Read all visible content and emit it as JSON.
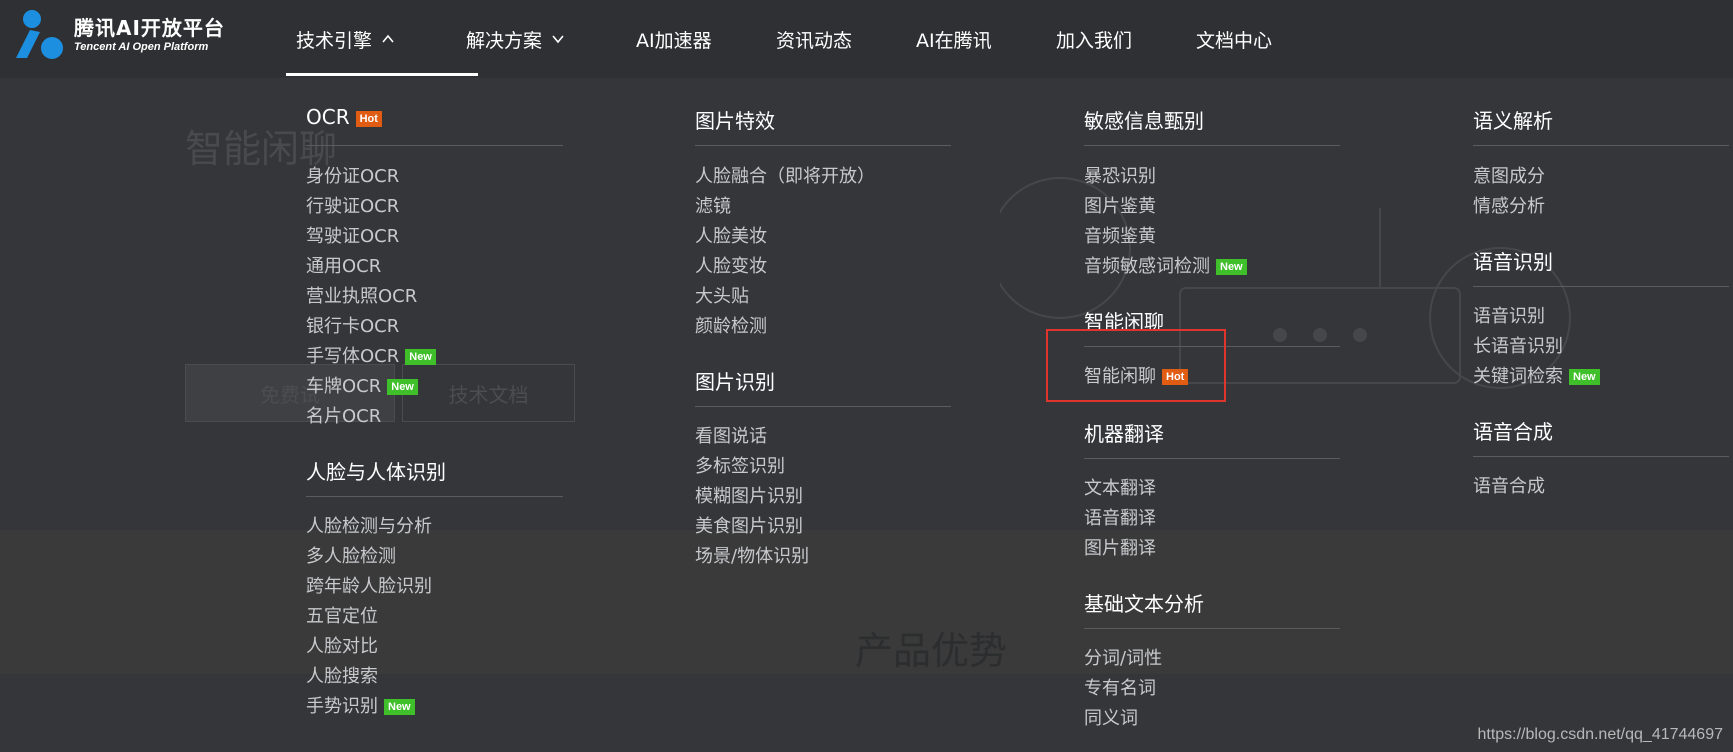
{
  "colors": {
    "hot_badge": "#e05c12",
    "new_badge": "#3fbf2a",
    "highlight_border": "#e0342f",
    "logo_blue": "#1d8fe0"
  },
  "logo": {
    "cn": "腾讯AI开放平台",
    "en": "Tencent AI Open Platform"
  },
  "nav": [
    {
      "label": "技术引擎",
      "chevron": "up"
    },
    {
      "label": "解决方案",
      "chevron": "down"
    },
    {
      "label": "AI加速器"
    },
    {
      "label": "资讯动态"
    },
    {
      "label": "AI在腾讯"
    },
    {
      "label": "加入我们"
    },
    {
      "label": "文档中心"
    }
  ],
  "menu": {
    "ocr": {
      "title": "OCR",
      "badge": "Hot",
      "items": [
        {
          "label": "身份证OCR"
        },
        {
          "label": "行驶证OCR"
        },
        {
          "label": "驾驶证OCR"
        },
        {
          "label": "通用OCR"
        },
        {
          "label": "营业执照OCR"
        },
        {
          "label": "银行卡OCR"
        },
        {
          "label": "手写体OCR",
          "badge": "New"
        },
        {
          "label": "车牌OCR",
          "badge": "New"
        },
        {
          "label": "名片OCR"
        }
      ]
    },
    "face": {
      "title": "人脸与人体识别",
      "items": [
        {
          "label": "人脸检测与分析"
        },
        {
          "label": "多人脸检测"
        },
        {
          "label": "跨年龄人脸识别"
        },
        {
          "label": "五官定位"
        },
        {
          "label": "人脸对比"
        },
        {
          "label": "人脸搜索"
        },
        {
          "label": "手势识别",
          "badge": "New"
        }
      ]
    },
    "effects": {
      "title": "图片特效",
      "items": [
        {
          "label": "人脸融合（即将开放）"
        },
        {
          "label": "滤镜"
        },
        {
          "label": "人脸美妆"
        },
        {
          "label": "人脸变妆"
        },
        {
          "label": "大头贴"
        },
        {
          "label": "颜龄检测"
        }
      ]
    },
    "image_rec": {
      "title": "图片识别",
      "items": [
        {
          "label": "看图说话"
        },
        {
          "label": "多标签识别"
        },
        {
          "label": "模糊图片识别"
        },
        {
          "label": "美食图片识别"
        },
        {
          "label": "场景/物体识别"
        }
      ]
    },
    "sensitive": {
      "title": "敏感信息甄别",
      "items": [
        {
          "label": "暴恐识别"
        },
        {
          "label": "图片鉴黄"
        },
        {
          "label": "音频鉴黄"
        },
        {
          "label": "音频敏感词检测",
          "badge": "New"
        }
      ]
    },
    "chat": {
      "title": "智能闲聊",
      "items": [
        {
          "label": "智能闲聊",
          "badge": "Hot"
        }
      ]
    },
    "translate": {
      "title": "机器翻译",
      "items": [
        {
          "label": "文本翻译"
        },
        {
          "label": "语音翻译"
        },
        {
          "label": "图片翻译"
        }
      ]
    },
    "text": {
      "title": "基础文本分析",
      "items": [
        {
          "label": "分词/词性"
        },
        {
          "label": "专有名词"
        },
        {
          "label": "同义词"
        }
      ]
    },
    "semantic": {
      "title": "语义解析",
      "items": [
        {
          "label": "意图成分"
        },
        {
          "label": "情感分析"
        }
      ]
    },
    "asr": {
      "title": "语音识别",
      "items": [
        {
          "label": "语音识别"
        },
        {
          "label": "长语音识别"
        },
        {
          "label": "关键词检索",
          "badge": "New"
        }
      ]
    },
    "tts": {
      "title": "语音合成",
      "items": [
        {
          "label": "语音合成"
        }
      ]
    }
  },
  "background_page": {
    "hero_title": "智能闲聊",
    "button_primary": "免费试",
    "button_secondary": "技术文档",
    "section_title": "产品优势"
  },
  "watermark": "https://blog.csdn.net/qq_41744697"
}
